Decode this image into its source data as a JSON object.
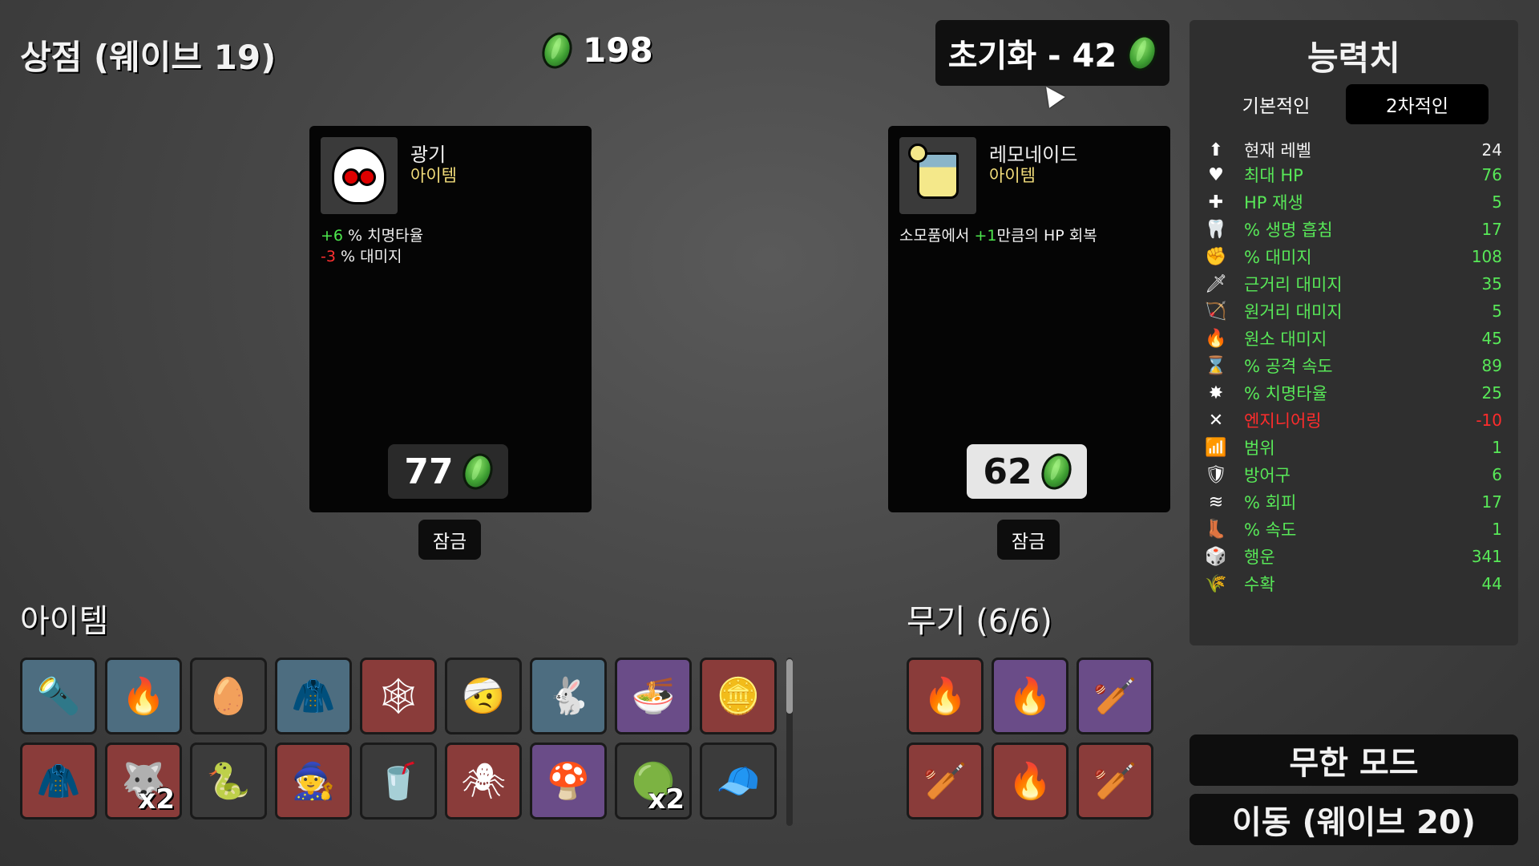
{
  "header": {
    "shop_title": "상점 (웨이브 19)",
    "materials": "198",
    "reroll_label": "초기화 - 42"
  },
  "shop": [
    {
      "name": "광기",
      "kind": "아이템",
      "effects": [
        {
          "value": "+6",
          "text": " % 치명타율",
          "color": "pos"
        },
        {
          "value": "-3",
          "text": " % 대미지",
          "color": "neg"
        }
      ],
      "price": "77",
      "lock_label": "잠금"
    },
    {
      "name": "레모네이드",
      "kind": "아이템",
      "desc_pre": "소모품에서 ",
      "desc_val": "+1",
      "desc_post": "만큼의 HP 회복",
      "price": "62",
      "lock_label": "잠금"
    }
  ],
  "items_section": {
    "title": "아이템",
    "items": [
      {
        "icon": "flashlight-icon",
        "glyph": "🔦",
        "tier": "t1"
      },
      {
        "icon": "campfire-icon",
        "glyph": "🔥",
        "tier": "t1"
      },
      {
        "icon": "egg-ghost-icon",
        "glyph": "🥚",
        "tier": "t0"
      },
      {
        "icon": "scarecrow-icon",
        "glyph": "🧥",
        "tier": "t1"
      },
      {
        "icon": "dreamcatcher-icon",
        "glyph": "🕸",
        "tier": "t3"
      },
      {
        "icon": "mummy-head-icon",
        "glyph": "🤕",
        "tier": "t0"
      },
      {
        "icon": "rabbit-knife-icon",
        "glyph": "🐇",
        "tier": "t1"
      },
      {
        "icon": "noodle-bowl-icon",
        "glyph": "🍜",
        "tier": "t2"
      },
      {
        "icon": "gold-coin-icon",
        "glyph": "🪙",
        "tier": "t3"
      },
      {
        "icon": "hoodie-icon",
        "glyph": "🧥",
        "tier": "t3"
      },
      {
        "icon": "wolf-helmet-icon",
        "glyph": "🐺",
        "tier": "t3",
        "qty": "x2"
      },
      {
        "icon": "snake-icon",
        "glyph": "🐍",
        "tier": "t0"
      },
      {
        "icon": "gnome-icon",
        "glyph": "🧙",
        "tier": "t3"
      },
      {
        "icon": "lemonade-icon",
        "glyph": "🥤",
        "tier": "t0"
      },
      {
        "icon": "spider-icon",
        "glyph": "🕷",
        "tier": "t3"
      },
      {
        "icon": "mushroom-icon",
        "glyph": "🍄",
        "tier": "t2"
      },
      {
        "icon": "green-slime-icon",
        "glyph": "🟢",
        "tier": "t0",
        "qty": "x2"
      },
      {
        "icon": "beanie-icon",
        "glyph": "🧢",
        "tier": "t0"
      }
    ]
  },
  "weapons_section": {
    "title": "무기 (6/6)",
    "weapons": [
      {
        "icon": "torch-icon",
        "glyph": "🔥",
        "tier": "t3"
      },
      {
        "icon": "torch-icon",
        "glyph": "🔥",
        "tier": "t2"
      },
      {
        "icon": "spiked-club-icon",
        "glyph": "🏏",
        "tier": "t2"
      },
      {
        "icon": "spiked-club-icon",
        "glyph": "🏏",
        "tier": "t3"
      },
      {
        "icon": "torch-icon",
        "glyph": "🔥",
        "tier": "t3"
      },
      {
        "icon": "spiked-club-icon",
        "glyph": "🏏",
        "tier": "t3"
      }
    ]
  },
  "stats": {
    "title": "능력치",
    "tab_primary": "기본적인",
    "tab_secondary": "2차적인",
    "rows": [
      {
        "icon": "level-icon",
        "glyph": "⬆",
        "label": "현재 레벨",
        "value": "24",
        "color": "white"
      },
      {
        "icon": "heart-icon",
        "glyph": "♥",
        "label": "최대 HP",
        "value": "76",
        "color": "green"
      },
      {
        "icon": "heart-plus-icon",
        "glyph": "✚",
        "label": "HP 재생",
        "value": "5",
        "color": "green"
      },
      {
        "icon": "fangs-icon",
        "glyph": "🦷",
        "label": "% 생명 흡침",
        "value": "17",
        "color": "green"
      },
      {
        "icon": "fist-icon",
        "glyph": "✊",
        "label": "% 대미지",
        "value": "108",
        "color": "green"
      },
      {
        "icon": "sword-icon",
        "glyph": "🗡",
        "label": "근거리 대미지",
        "value": "35",
        "color": "green"
      },
      {
        "icon": "bow-icon",
        "glyph": "🏹",
        "label": "원거리 대미지",
        "value": "5",
        "color": "green"
      },
      {
        "icon": "flame-icon",
        "glyph": "🔥",
        "label": "원소 대미지",
        "value": "45",
        "color": "green"
      },
      {
        "icon": "hourglass-icon",
        "glyph": "⌛",
        "label": "% 공격 속도",
        "value": "89",
        "color": "green"
      },
      {
        "icon": "crit-burst-icon",
        "glyph": "✸",
        "label": "% 치명타율",
        "value": "25",
        "color": "green"
      },
      {
        "icon": "wrench-cross-icon",
        "glyph": "✕",
        "label": "엔지니어링",
        "value": "-10",
        "color": "red"
      },
      {
        "icon": "range-waves-icon",
        "glyph": "📶",
        "label": "범위",
        "value": "1",
        "color": "green"
      },
      {
        "icon": "shield-icon",
        "glyph": "🛡",
        "label": "방어구",
        "value": "6",
        "color": "green"
      },
      {
        "icon": "dodge-wind-icon",
        "glyph": "≋",
        "label": "% 회피",
        "value": "17",
        "color": "green"
      },
      {
        "icon": "boot-icon",
        "glyph": "👢",
        "label": "% 속도",
        "value": "1",
        "color": "green"
      },
      {
        "icon": "dice-icon",
        "glyph": "🎲",
        "label": "행운",
        "value": "341",
        "color": "green"
      },
      {
        "icon": "wheat-icon",
        "glyph": "🌾",
        "label": "수확",
        "value": "44",
        "color": "green"
      }
    ]
  },
  "buttons": {
    "endless_mode": "무한 모드",
    "go_next": "이동 (웨이브 20)"
  }
}
